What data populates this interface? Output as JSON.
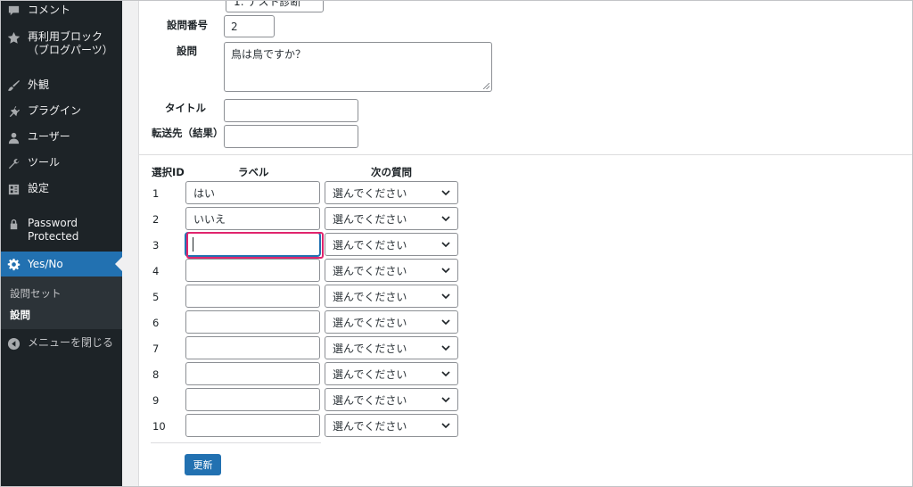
{
  "sidebar": {
    "items": [
      {
        "label": "コメント",
        "icon": "comment-icon"
      },
      {
        "label": "再利用ブロック\n（ブログパーツ）",
        "icon": "star-icon"
      },
      {
        "label": "外観",
        "icon": "brush-icon"
      },
      {
        "label": "プラグイン",
        "icon": "plugin-icon"
      },
      {
        "label": "ユーザー",
        "icon": "user-icon"
      },
      {
        "label": "ツール",
        "icon": "wrench-icon"
      },
      {
        "label": "設定",
        "icon": "settings-icon"
      },
      {
        "label": "Password\nProtected",
        "icon": "lock-icon"
      },
      {
        "label": "Yes/No",
        "icon": "gear-icon"
      }
    ],
    "submenu": [
      {
        "label": "設問セット"
      },
      {
        "label": "設問"
      }
    ],
    "collapse_label": "メニューを閉じる"
  },
  "form": {
    "set_select_value": "1: テスト診断",
    "question_number_label": "設問番号",
    "question_number_value": "2",
    "question_label": "設問",
    "question_value": "鳥は鳥ですか？",
    "title_label": "タイトル",
    "title_value": "",
    "redirect_label": "転送先（結果）",
    "redirect_value": ""
  },
  "choices": {
    "headers": {
      "id": "選択ID",
      "label": "ラベル",
      "next": "次の質問"
    },
    "select_placeholder": "選んでください",
    "rows": [
      {
        "id": "1",
        "label": "はい"
      },
      {
        "id": "2",
        "label": "いいえ"
      },
      {
        "id": "3",
        "label": ""
      },
      {
        "id": "4",
        "label": ""
      },
      {
        "id": "5",
        "label": ""
      },
      {
        "id": "6",
        "label": ""
      },
      {
        "id": "7",
        "label": ""
      },
      {
        "id": "8",
        "label": ""
      },
      {
        "id": "9",
        "label": ""
      },
      {
        "id": "10",
        "label": ""
      }
    ]
  },
  "update_button_label": "更新",
  "colors": {
    "accent": "#2271b1",
    "highlight": "#e0246d",
    "sidebar": "#1d2327"
  }
}
